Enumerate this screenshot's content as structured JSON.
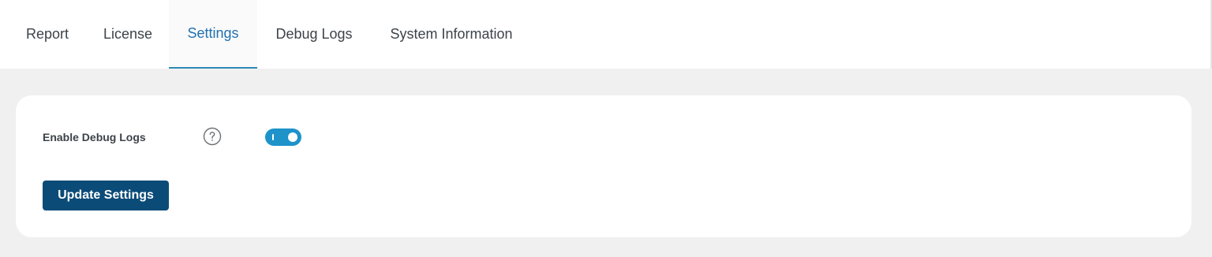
{
  "tabs": {
    "report": "Report",
    "license": "License",
    "settings": "Settings",
    "debug_logs": "Debug Logs",
    "system_information": "System Information",
    "active": "Settings"
  },
  "settings": {
    "debug_logs_label": "Enable Debug Logs",
    "help_icon": "question-circle-icon",
    "debug_logs_enabled": true,
    "update_button_label": "Update Settings"
  },
  "colors": {
    "accent": "#2271b1",
    "toggle_on": "#1d93c9",
    "button": "#0a4b78",
    "background": "#f0f0f1"
  }
}
